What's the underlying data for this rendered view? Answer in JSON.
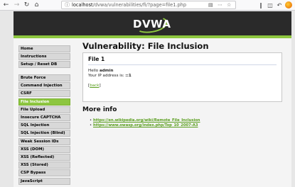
{
  "browser": {
    "url_host": "localhost",
    "url_path": "/dvwa/vulnerabilities/fi/?page=file1.php"
  },
  "app": {
    "logo_text": "DVWA",
    "brand_color": "#8dc63f",
    "header_color": "#2a2a2a"
  },
  "sidebar": {
    "group1": [
      {
        "label": "Home"
      },
      {
        "label": "Instructions"
      },
      {
        "label": "Setup / Reset DB"
      }
    ],
    "group2": [
      {
        "label": "Brute Force"
      },
      {
        "label": "Command Injection"
      },
      {
        "label": "CSRF"
      },
      {
        "label": "File Inclusion",
        "selected": true
      },
      {
        "label": "File Upload"
      },
      {
        "label": "Insecure CAPTCHA"
      },
      {
        "label": "SQL Injection"
      },
      {
        "label": "SQL Injection (Blind)"
      },
      {
        "label": "Weak Session IDs"
      },
      {
        "label": "XSS (DOM)"
      },
      {
        "label": "XSS (Reflected)"
      },
      {
        "label": "XSS (Stored)"
      },
      {
        "label": "CSP Bypass"
      },
      {
        "label": "JavaScript"
      }
    ]
  },
  "main": {
    "title": "Vulnerability: File Inclusion",
    "box": {
      "heading": "File 1",
      "hello_prefix": "Hello ",
      "user": "admin",
      "ip_prefix": "Your IP address is: ",
      "ip": "::1",
      "back_open": "[",
      "back_label": "back",
      "back_close": "]"
    },
    "more_info": {
      "title": "More info",
      "links": [
        "https://en.wikipedia.org/wiki/Remote_File_Inclusion",
        "https://www.owasp.org/index.php/Top_10_2007-A3"
      ]
    }
  }
}
